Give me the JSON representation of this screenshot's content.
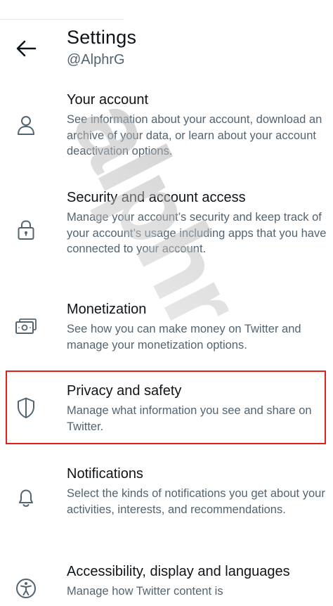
{
  "header": {
    "title": "Settings",
    "handle": "@AlphrG",
    "back_icon": "arrow-left-icon"
  },
  "menu": [
    {
      "id": "your-account",
      "icon": "person-icon",
      "label": "Your account",
      "description": "See information about your account, download an archive of your data, or learn about your account deactivation options."
    },
    {
      "id": "security",
      "icon": "lock-icon",
      "label": "Security and account access",
      "description": "Manage your account’s security and keep track of your account’s usage including apps that you have connected to your account."
    },
    {
      "id": "monetization",
      "icon": "money-icon",
      "label": "Monetization",
      "description": "See how you can make money on Twitter and manage your monetization options."
    },
    {
      "id": "privacy",
      "icon": "shield-icon",
      "label": "Privacy and safety",
      "description": "Manage what information you see and share on Twitter.",
      "highlighted": true
    },
    {
      "id": "notifications",
      "icon": "bell-icon",
      "label": "Notifications",
      "description": "Select the kinds of notifications you get about your activities, interests, and recommendations."
    },
    {
      "id": "accessibility",
      "icon": "accessibility-icon",
      "label": "Accessibility, display and languages",
      "description": "Manage how Twitter content is"
    }
  ],
  "colors": {
    "highlight": "#e0201b",
    "text_primary": "#0f1419",
    "text_secondary": "#536471"
  },
  "watermark": "alphr"
}
